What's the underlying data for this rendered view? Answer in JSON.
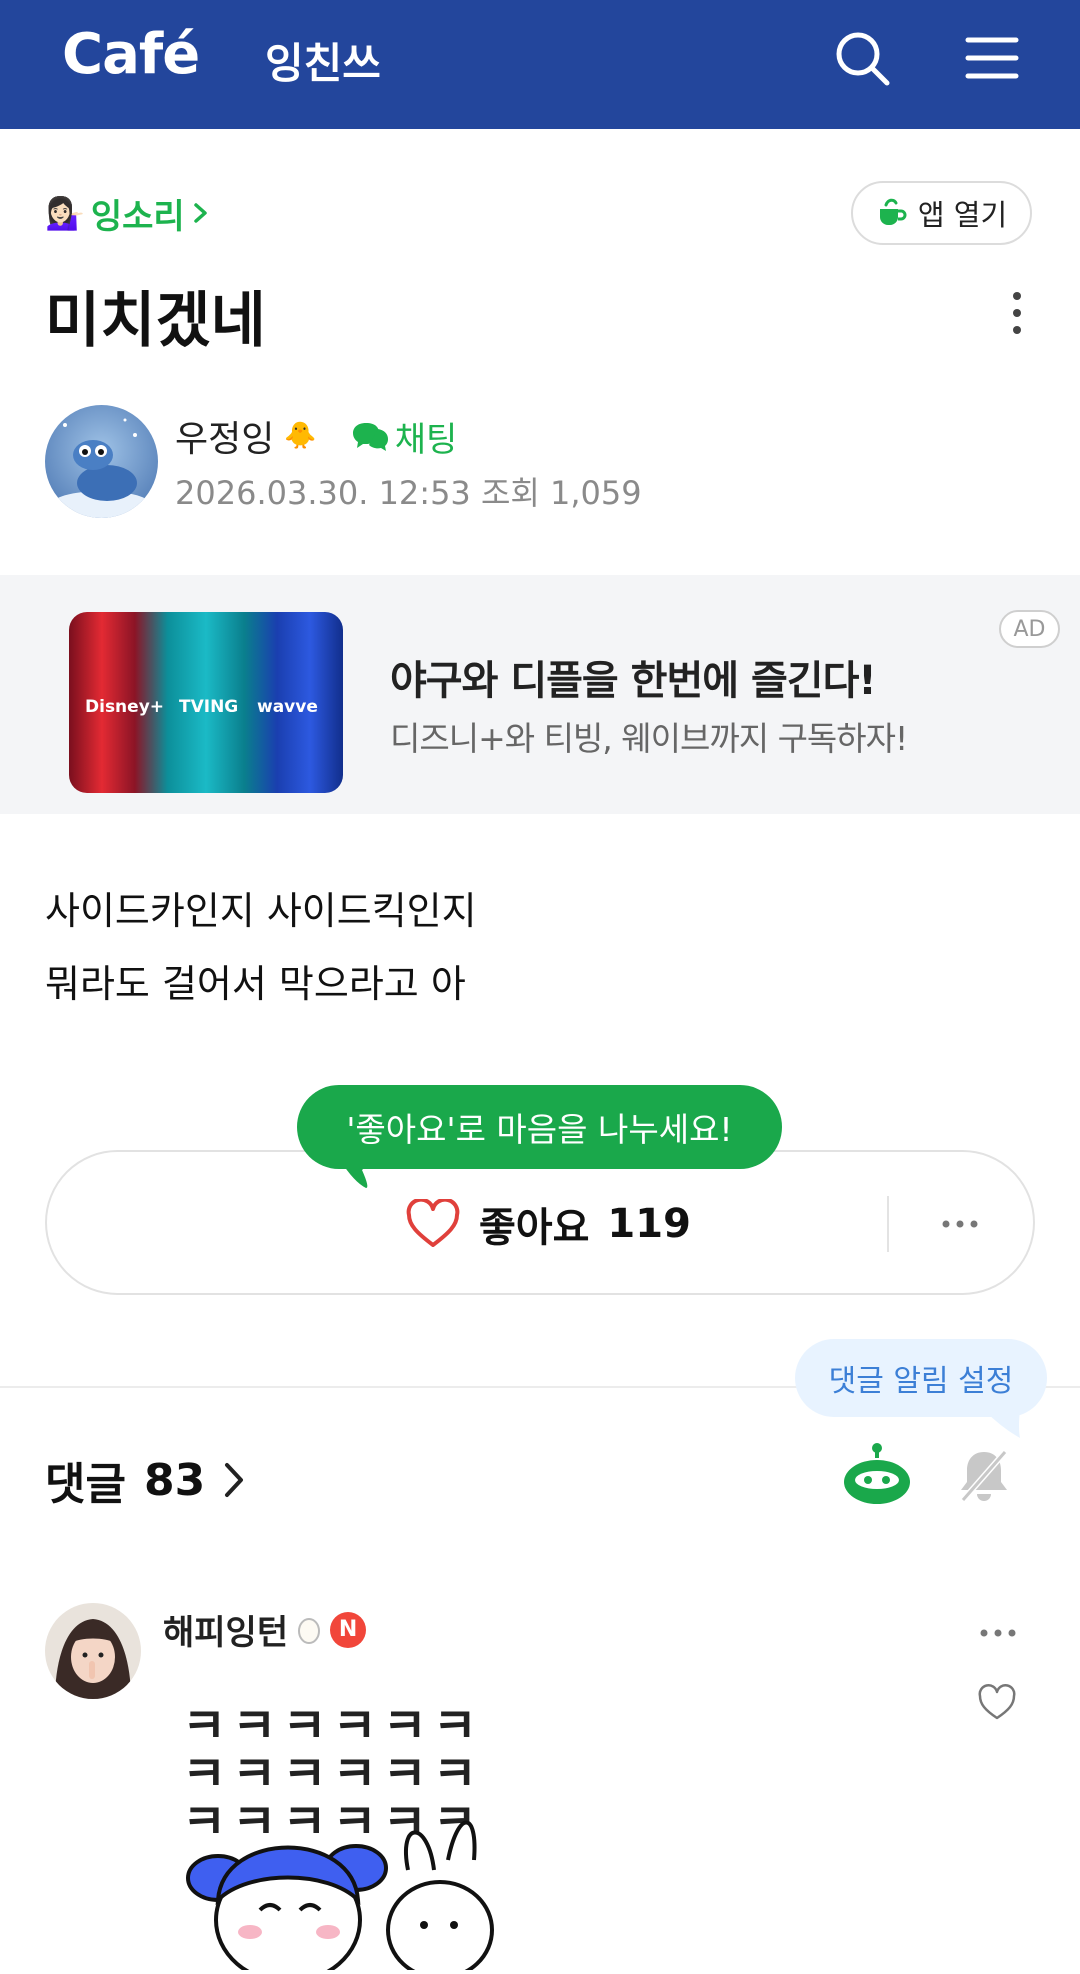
{
  "header": {
    "logo": "Café",
    "cafe_name": "잉친쓰",
    "icons": [
      "search-icon",
      "menu-icon"
    ],
    "color": "#23469c"
  },
  "post": {
    "board_emoji": "💁🏻‍♀️",
    "board": "잉소리",
    "app_button": "앱 열기",
    "title": "미치겠네",
    "author": "우정잉",
    "author_badge": "🐥",
    "chat_label": "채팅",
    "datetime": "2026.03.30. 12:53",
    "views_label": "조회",
    "views": "1,059",
    "body": [
      "사이드카인지 사이드킥인지",
      "뭐라도 걸어서 막으라고 아"
    ]
  },
  "ad": {
    "headline": "야구와 디플을 한번에 즐긴다!",
    "subline": "디즈니+와 티빙, 웨이브까지 구독하자!",
    "badge": "AD",
    "brands": [
      "Disney+",
      "TVING",
      "wavve"
    ]
  },
  "like": {
    "tooltip": "'좋아요'로 마음을 나누세요!",
    "label": "좋아요",
    "count": "119"
  },
  "comments": {
    "alarm_tooltip": "댓글 알림 설정",
    "label": "댓글",
    "count": "83",
    "items": [
      {
        "user": "해피잉턴",
        "badge": "N",
        "sticker_text": "ㅋㅋㅋㅋㅋㅋ"
      }
    ]
  },
  "colors": {
    "accent_green": "#1db34e",
    "header_blue": "#23469c",
    "like_red": "#e0403b"
  }
}
